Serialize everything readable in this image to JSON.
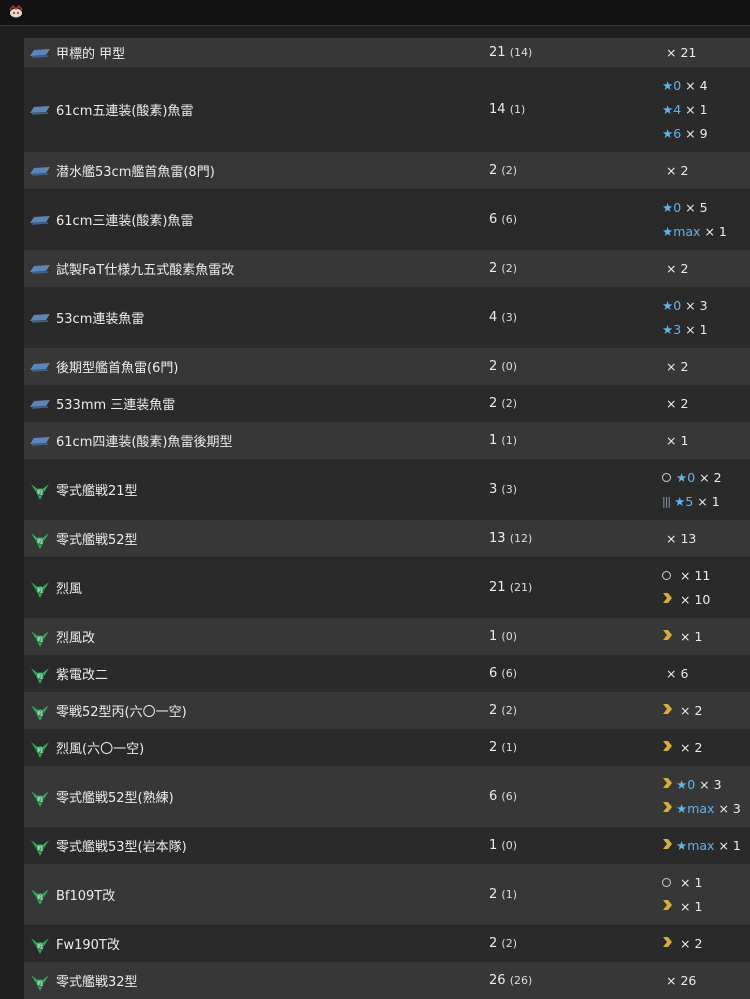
{
  "colors": {
    "star": "#5fb4ec",
    "chevron": "#d6ae3a",
    "torpedo": "#5b87b8",
    "fighter": "#29b05c"
  },
  "rows": [
    {
      "icon": "torpedo-icon",
      "name": "甲標的 甲型",
      "count": "21",
      "sub": "(14)",
      "details": [
        {
          "mult": "× 21"
        }
      ]
    },
    {
      "icon": "torpedo-icon",
      "name": "61cm五連装(酸素)魚雷",
      "count": "14",
      "sub": "(1)",
      "details": [
        {
          "star": "★0",
          "mult": "× 4"
        },
        {
          "star": "★4",
          "mult": "× 1"
        },
        {
          "star": "★6",
          "mult": "× 9"
        }
      ]
    },
    {
      "icon": "torpedo-icon",
      "name": "潜水艦53cm艦首魚雷(8門)",
      "count": "2",
      "sub": "(2)",
      "details": [
        {
          "mult": "× 2"
        }
      ]
    },
    {
      "icon": "torpedo-icon",
      "name": "61cm三連装(酸素)魚雷",
      "count": "6",
      "sub": "(6)",
      "details": [
        {
          "star": "★0",
          "mult": "× 5"
        },
        {
          "star": "★max",
          "mult": "× 1"
        }
      ]
    },
    {
      "icon": "torpedo-icon",
      "name": "試製FaT仕様九五式酸素魚雷改",
      "count": "2",
      "sub": "(2)",
      "details": [
        {
          "mult": "× 2"
        }
      ]
    },
    {
      "icon": "torpedo-icon",
      "name": "53cm連装魚雷",
      "count": "4",
      "sub": "(3)",
      "details": [
        {
          "star": "★0",
          "mult": "× 3"
        },
        {
          "star": "★3",
          "mult": "× 1"
        }
      ]
    },
    {
      "icon": "torpedo-icon",
      "name": "後期型艦首魚雷(6門)",
      "count": "2",
      "sub": "(0)",
      "details": [
        {
          "mult": "× 2"
        }
      ]
    },
    {
      "icon": "torpedo-icon",
      "name": "533mm 三連装魚雷",
      "count": "2",
      "sub": "(2)",
      "details": [
        {
          "mult": "× 2"
        }
      ]
    },
    {
      "icon": "torpedo-icon",
      "name": "61cm四連装(酸素)魚雷後期型",
      "count": "1",
      "sub": "(1)",
      "details": [
        {
          "mult": "× 1"
        }
      ]
    },
    {
      "icon": "fighter-icon",
      "name": "零式艦戦21型",
      "count": "3",
      "sub": "(3)",
      "details": [
        {
          "mark": "ring",
          "star": "★0",
          "mult": "× 2"
        },
        {
          "mark": "bars",
          "star": "★5",
          "mult": "× 1"
        }
      ]
    },
    {
      "icon": "fighter-icon",
      "name": "零式艦戦52型",
      "count": "13",
      "sub": "(12)",
      "details": [
        {
          "mult": "× 13"
        }
      ]
    },
    {
      "icon": "fighter-icon",
      "name": "烈風",
      "count": "21",
      "sub": "(21)",
      "details": [
        {
          "mark": "ring",
          "mult": "× 11"
        },
        {
          "mark": "chevron",
          "mult": "× 10"
        }
      ]
    },
    {
      "icon": "fighter-icon",
      "name": "烈風改",
      "count": "1",
      "sub": "(0)",
      "details": [
        {
          "mark": "chevron",
          "mult": "× 1"
        }
      ]
    },
    {
      "icon": "fighter-icon",
      "name": "紫電改二",
      "count": "6",
      "sub": "(6)",
      "details": [
        {
          "mult": "× 6"
        }
      ]
    },
    {
      "icon": "fighter-icon",
      "name": "零戦52型丙(六〇一空)",
      "count": "2",
      "sub": "(2)",
      "details": [
        {
          "mark": "chevron",
          "mult": "× 2"
        }
      ]
    },
    {
      "icon": "fighter-icon",
      "name": "烈風(六〇一空)",
      "count": "2",
      "sub": "(1)",
      "details": [
        {
          "mark": "chevron",
          "mult": "× 2"
        }
      ]
    },
    {
      "icon": "fighter-icon",
      "name": "零式艦戦52型(熟練)",
      "count": "6",
      "sub": "(6)",
      "details": [
        {
          "mark": "chevron",
          "star": "★0",
          "mult": "× 3"
        },
        {
          "mark": "chevron",
          "star": "★max",
          "mult": "× 3"
        }
      ]
    },
    {
      "icon": "fighter-icon",
      "name": "零式艦戦53型(岩本隊)",
      "count": "1",
      "sub": "(0)",
      "details": [
        {
          "mark": "chevron",
          "star": "★max",
          "mult": "× 1"
        }
      ]
    },
    {
      "icon": "fighter-icon",
      "name": "Bf109T改",
      "count": "2",
      "sub": "(1)",
      "details": [
        {
          "mark": "ring",
          "mult": "× 1"
        },
        {
          "mark": "chevron",
          "mult": "× 1"
        }
      ]
    },
    {
      "icon": "fighter-icon",
      "name": "Fw190T改",
      "count": "2",
      "sub": "(2)",
      "details": [
        {
          "mark": "chevron",
          "mult": "× 2"
        }
      ]
    },
    {
      "icon": "fighter-icon",
      "name": "零式艦戦32型",
      "count": "26",
      "sub": "(26)",
      "details": [
        {
          "mult": "× 26"
        }
      ]
    }
  ]
}
